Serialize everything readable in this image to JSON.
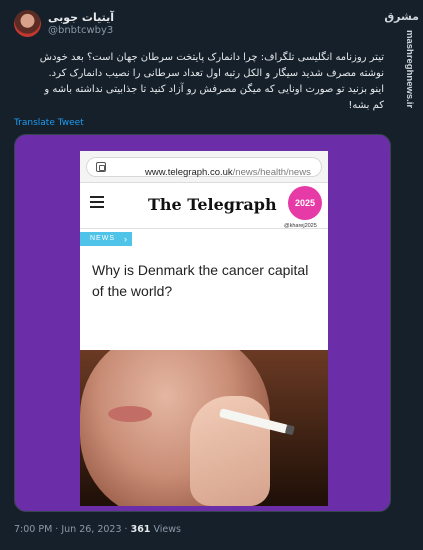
{
  "user": {
    "name": "آیتیات جوبی",
    "handle": "@bnbtcwby3"
  },
  "tweet": {
    "lines": [
      "تیتر روزنامه انگلیسی تلگراف: چرا دانمارک پایتخت سرطان جهان است؟ بعد خودش",
      "نوشته مصرف شدید سیگار و الکل رتبه اول تعداد سرطانی را نصیب دانمارک کرد.",
      "اینو بزنید تو صورت اونایی که میگن مصرفش رو آزاد کنید تا جذابیتی نداشته باشه و",
      "کم بشه!"
    ],
    "translate_label": "Translate Tweet",
    "time": "7:00 PM · Jun 26, 2023 · ",
    "views_count": "361",
    "views_label": " Views"
  },
  "screenshot": {
    "url_domain": "www.telegraph.co.uk",
    "url_path": "/news/health/news",
    "masthead": "The Telegraph",
    "badge_text": "2025",
    "badge_handle": "@kharej2025",
    "tag": "NEWS",
    "headline": "Why is Denmark the cancer capital of the world?"
  },
  "watermark": {
    "logo": "مشرق",
    "site": "mashreghnews.ir"
  },
  "colors": {
    "background": "#15202b",
    "accent": "#1d9bf0",
    "media_frame": "#6b2da8",
    "news_tag": "#4fc3e8"
  },
  "icons": [
    "page-icon",
    "hamburger-icon",
    "arrow-right-icon"
  ]
}
